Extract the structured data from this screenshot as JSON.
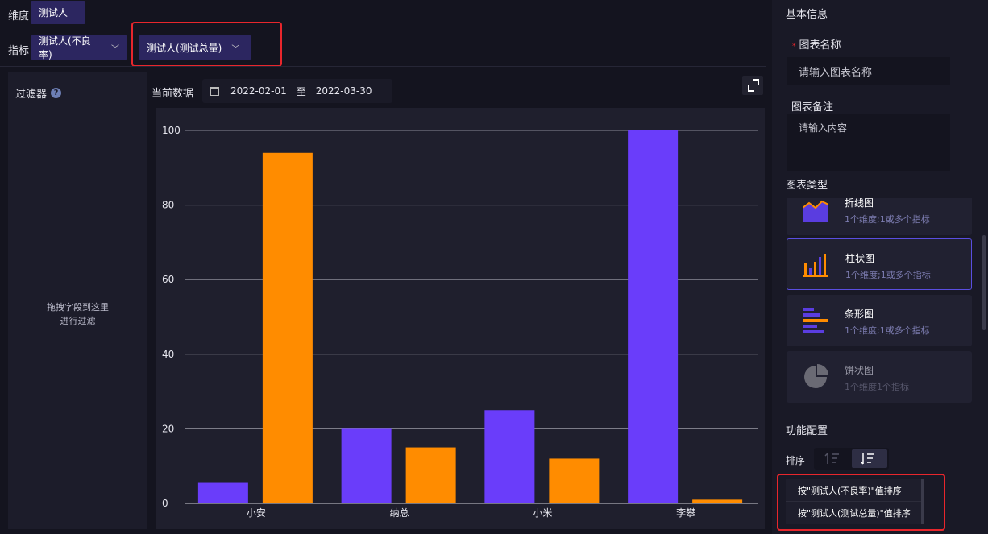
{
  "dimension": {
    "label": "维度",
    "value": "测试人"
  },
  "metric": {
    "label": "指标",
    "items": [
      "测试人(不良率)",
      "测试人(测试总量)"
    ]
  },
  "filter": {
    "title": "过滤器",
    "hint_line1": "拖拽字段到这里",
    "hint_line2": "进行过滤"
  },
  "date_range": {
    "label": "当前数据",
    "start": "2022-02-01",
    "separator": "至",
    "end": "2022-03-30"
  },
  "chart_data": {
    "type": "bar",
    "categories": [
      "小安",
      "纳总",
      "小米",
      "李攀"
    ],
    "series": [
      {
        "values": [
          5.5,
          20,
          25,
          100
        ],
        "color": "#6a3dfa"
      },
      {
        "values": [
          94,
          15,
          12,
          1
        ],
        "color": "#ff8c00"
      }
    ],
    "ylim": [
      0,
      100
    ],
    "yticks": [
      "0",
      "20",
      "40",
      "60",
      "80",
      "100"
    ],
    "grid": true
  },
  "settings": {
    "section_basic": "基本信息",
    "chart_name_label": "图表名称",
    "chart_name_placeholder": "请输入图表名称",
    "chart_note_label": "图表备注",
    "chart_note_placeholder": "请输入内容",
    "chart_type_label": "图表类型",
    "chart_types": [
      {
        "name": "折线图",
        "desc": "1个维度;1或多个指标"
      },
      {
        "name": "柱状图",
        "desc": "1个维度;1或多个指标"
      },
      {
        "name": "条形图",
        "desc": "1个维度;1或多个指标"
      },
      {
        "name": "饼状图",
        "desc": "1个维度1个指标"
      }
    ],
    "function_label": "功能配置",
    "sort_label": "排序",
    "sort_options": [
      "按\"测试人(不良率)\"值排序",
      "按\"测试人(测试总量)\"值排序"
    ]
  },
  "colors": {
    "accent": "#6a3dfa",
    "orange": "#ff8c00",
    "highlight": "#e8262c"
  }
}
